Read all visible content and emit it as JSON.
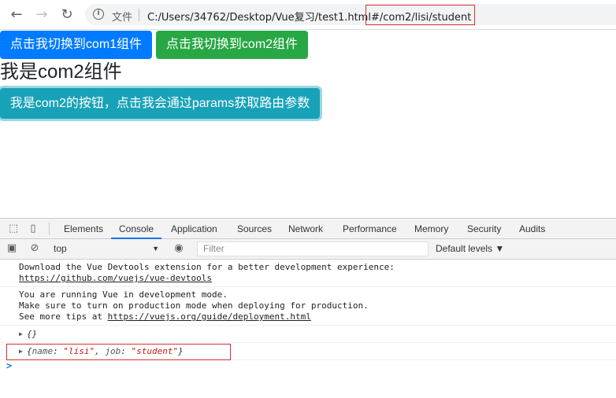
{
  "browser": {
    "file_label": "文件",
    "url_path": "C:/Users/34762/Desktop/Vue复习/test1.html",
    "url_hash": "#/com2/lisi/student"
  },
  "page": {
    "btn_com1": "点击我切换到com1组件",
    "btn_com2": "点击我切换到com2组件",
    "heading": "我是com2组件",
    "btn_params": "我是com2的按钮，点击我会通过params获取路由参数"
  },
  "devtools": {
    "tabs": [
      "Elements",
      "Console",
      "Application",
      "Sources",
      "Network",
      "Performance",
      "Memory",
      "Security",
      "Audits"
    ],
    "active_tab": "Console",
    "context": "top",
    "filter_placeholder": "Filter",
    "levels": "Default levels ▼",
    "messages": {
      "m1_line1": "Download the Vue Devtools extension for a better development experience:",
      "m1_link": "https://github.com/vuejs/vue-devtools",
      "m2_line1": "You are running Vue in development mode.",
      "m2_line2": "Make sure to turn on production mode when deploying for production.",
      "m2_line3_prefix": "See more tips at ",
      "m2_link": "https://vuejs.org/guide/deployment.html",
      "obj1": "{}",
      "obj2_open": "{",
      "obj2_k1": "name",
      "obj2_v1": "\"lisi\"",
      "obj2_k2": "job",
      "obj2_v2": "\"student\"",
      "obj2_close": "}"
    },
    "prompt": ">"
  },
  "colors": {
    "primary": "#007bff",
    "success": "#28a745",
    "info": "#17a2b8",
    "highlight": "#d9302c"
  }
}
